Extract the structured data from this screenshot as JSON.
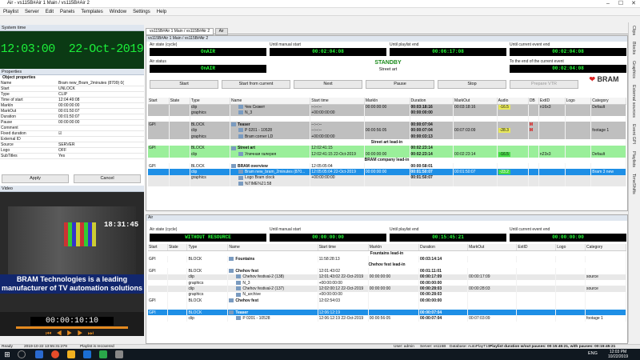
{
  "window": {
    "title": "Air - vs115B#Air 1 Main / vs115B#Air 2"
  },
  "menu": [
    "Playlist",
    "Server",
    "Edit",
    "Panels",
    "Templates",
    "Window",
    "Settings",
    "Help"
  ],
  "system_time": {
    "header": "System time",
    "time": "12:03:00",
    "date": "22-Oct-2019"
  },
  "properties": {
    "header": "Properties",
    "group": "Object properties",
    "rows": [
      [
        "Name",
        "Bram new_Bram_2minutes (8709) 0("
      ],
      [
        "Start",
        "UNLOCK"
      ],
      [
        "Type",
        "CLIP"
      ],
      [
        "Time of start",
        "12:04:49:08"
      ],
      [
        "MarkIn",
        "00:00:00:00"
      ],
      [
        "MarkOut",
        "00:01:50:07"
      ],
      [
        "Duration",
        "00:01:50:07"
      ],
      [
        "Pause",
        "00:00:00:00"
      ],
      [
        "Comment",
        ""
      ],
      [
        "Fixed duration",
        "☑"
      ],
      [
        "External ID",
        ""
      ],
      [
        "Source",
        "SERVER"
      ],
      [
        "Logo",
        "OFF"
      ],
      [
        "SubTitles",
        "Yes"
      ]
    ],
    "apply": "Apply",
    "cancel": "Cancel"
  },
  "video": {
    "header": "Video",
    "caption": "BRAM Technologies is a leading manufacturer of TV automation solutions",
    "clock": "18:31:45",
    "timecode": "00:00:10:10"
  },
  "tabs": [
    "vs115B#Air 1 Main / vs115B#Air 2",
    "Air"
  ],
  "air1": {
    "state_label": "Air state (cycle)",
    "state": "OnAIR",
    "manual_label": "Until manual start",
    "manual": "00:02:04:08",
    "pl_end_label": "Until playlist end",
    "pl_end": "00:06:17:08",
    "ev_end_label": "Until current event end",
    "ev_end": "00:02:04:08",
    "status_label": "Air status",
    "status": "OnAIR",
    "standby": "STANDBY",
    "street": "Street art",
    "next_label": "To the end of the current event",
    "next": "00:02:04:08",
    "buttons": [
      "Start",
      "Start from current",
      "Next",
      "Pause",
      "Stop",
      "Prepare VTR"
    ],
    "logo": "BRAM"
  },
  "grid_headers": [
    "Start",
    "State",
    "Type",
    "Name",
    "Start time",
    "MarkIn",
    "Duration",
    "MarkOut",
    "Audio",
    "DB",
    "ExtID",
    "Logo",
    "Category"
  ],
  "grid1": [
    {
      "c": "gr",
      "start": "",
      "type": "clip",
      "name": "Чек Сюжет",
      "st": "--:--:--",
      "mi": "00:00:00:00",
      "du": "00:03:18:16",
      "mo": "00:03:18:16",
      "au": "-16.5",
      "db": "",
      "ext": "n16x3",
      "cat": "Default"
    },
    {
      "c": "gr",
      "start": "",
      "type": "graphics",
      "name": "N_3",
      "st": "+00:00:00:00",
      "mi": "",
      "du": "00:00:00:00",
      "mo": "",
      "au": "",
      "db": "",
      "ext": "",
      "cat": ""
    },
    {
      "c": "wh",
      "start": "",
      "type": "",
      "name": "",
      "st": "",
      "mi": "",
      "du": "",
      "mo": "",
      "au": "",
      "db": "",
      "ext": "",
      "cat": ""
    },
    {
      "c": "gr",
      "start": "GPI",
      "type": "BLOCK",
      "name": "Teaser",
      "st": "--:--:--",
      "mi": "",
      "du": "00:00:07:04",
      "mo": "",
      "au": "",
      "db": "M",
      "ext": "",
      "cat": ""
    },
    {
      "c": "gr",
      "start": "",
      "type": "clip",
      "name": "P 0201 - 10528",
      "st": "--:--:--",
      "mi": "00:00:56:05",
      "du": "00:00:07:04",
      "mo": "00:07:03:09",
      "au": "-28.3",
      "db": "M",
      "ext": "",
      "cat": "footage 1"
    },
    {
      "c": "gr",
      "start": "",
      "type": "graphics",
      "name": "Bram corner LD",
      "st": "+00:00:00:00",
      "mi": "",
      "du": "00:00:03:13",
      "mo": "",
      "au": "",
      "db": "",
      "ext": "",
      "cat": ""
    },
    {
      "sec": "Street art lead-in"
    },
    {
      "c": "g",
      "start": "GPI",
      "type": "BLOCK",
      "name": "Street art",
      "st": "12:02:41:15",
      "mi": "",
      "du": "00:02:23:14",
      "mo": "",
      "au": "",
      "db": "",
      "ext": "",
      "cat": ""
    },
    {
      "c": "g",
      "start": "",
      "type": "clip",
      "name": "Уличная галерея",
      "st": "12:02:41:15  22-Oct-2019",
      "mi": "00:00:00:00",
      "du": "00:02:23:14",
      "mo": "00:02:23:14",
      "au": "-16.5",
      "db": "",
      "ext": "n23x3",
      "cat": "Default"
    },
    {
      "sec": "BRAM company lead-in"
    },
    {
      "c": "wh",
      "start": "GPI",
      "type": "BLOCK",
      "name": "BRAM overview",
      "st": "12:05:05:04",
      "mi": "",
      "du": "00:00:58:01",
      "mo": "",
      "au": "",
      "db": "",
      "ext": "",
      "cat": ""
    },
    {
      "c": "bl",
      "start": "",
      "type": "clip",
      "name": "Bram new_bram_2minutes (870...",
      "st": "12:05:05:04  22-Oct-2019",
      "mi": "00:00:00:00",
      "du": "00:01:50:07",
      "mo": "00:01:50:07",
      "au": "-23.2",
      "db": "",
      "ext": "",
      "cat": "Bram 3 new"
    },
    {
      "c": "ltg",
      "start": "",
      "type": "graphics",
      "name": "Logo Bram clock",
      "st": "+00:00:00:00",
      "mi": "",
      "du": "00:01:50:07",
      "mo": "",
      "au": "",
      "db": "",
      "ext": "",
      "cat": ""
    },
    {
      "c": "ltg",
      "start": "",
      "type": "",
      "name": "%TIME%21:58",
      "st": "",
      "mi": "",
      "du": "",
      "mo": "",
      "au": "",
      "db": "",
      "ext": "",
      "cat": ""
    }
  ],
  "air2": {
    "tab": "Air",
    "state": "WITHOUT RESOURCE",
    "manual": "00:00:00:00",
    "pl_end": "00:15:45:21",
    "ev_end": "00:00:00:00"
  },
  "grid2_headers": [
    "Start",
    "State",
    "Type",
    "Name",
    "Start time",
    "MarkIn",
    "Duration",
    "MarkOut",
    "ExtID",
    "Logo",
    "Category"
  ],
  "grid2": [
    {
      "sec": "Fountains lead-in"
    },
    {
      "c": "wh",
      "start": "GPI",
      "type": "BLOCK",
      "name": "Fountains",
      "st": "11:58:28:13",
      "mi": "",
      "du": "00:03:14:14",
      "mo": "",
      "cat": ""
    },
    {
      "sec": "Chehov fest lead-in"
    },
    {
      "c": "wh",
      "start": "GPI",
      "type": "BLOCK",
      "name": "Chehov fest",
      "st": "12:01:43:02",
      "mi": "",
      "du": "00:01:11:01",
      "mo": "",
      "cat": ""
    },
    {
      "c": "ltg",
      "start": "",
      "type": "clip",
      "name": "Chehov festival-2 (138)",
      "st": "12:01:43:02  22-Oct-2019",
      "mi": "00:00:00:00",
      "du": "00:00:17:09",
      "mo": "00:00:17:09",
      "cat": "source"
    },
    {
      "c": "wh",
      "start": "",
      "type": "graphics",
      "name": "N_3",
      "st": "+00:00:00:00",
      "mi": "",
      "du": "00:00:00:00",
      "mo": "",
      "cat": ""
    },
    {
      "c": "ltg",
      "start": "",
      "type": "clip",
      "name": "Chehov festival-2 (137)",
      "st": "12:02:00:12  22-Oct-2019",
      "mi": "00:00:00:00",
      "du": "00:00:28:03",
      "mo": "00:00:28:03",
      "cat": "source"
    },
    {
      "c": "wh",
      "start": "",
      "type": "graphics",
      "name": "N_archive",
      "st": "+00:00:00:00",
      "mi": "",
      "du": "00:00:28:03",
      "mo": "",
      "cat": ""
    },
    {
      "c": "wh",
      "start": "GPI",
      "type": "BLOCK",
      "name": "Chehov fest",
      "st": "12:02:54:03",
      "mi": "",
      "du": "00:00:00:00",
      "mo": "",
      "cat": ""
    },
    {
      "c": "wh",
      "start": "",
      "type": "",
      "name": "",
      "st": "",
      "mi": "",
      "du": "",
      "mo": "",
      "cat": ""
    },
    {
      "c": "bl",
      "start": "GPI",
      "type": "BLOCK",
      "name": "Teaser",
      "st": "12:06:12:19",
      "mi": "",
      "du": "00:00:07:04",
      "mo": "",
      "cat": ""
    },
    {
      "c": "wh",
      "start": "",
      "type": "clip",
      "name": "P 0201 - 10528",
      "st": "12:06:12:19  22-Oct-2019",
      "mi": "00:00:56:05",
      "du": "00:00:07:04",
      "mo": "00:07:03:09",
      "cat": "footage 1"
    }
  ],
  "vtabs": [
    "Clips",
    "Blocks",
    "Graphics",
    "External sources",
    "Event GPI",
    "Playlists",
    "TimeShifts"
  ],
  "status": {
    "ready": "Ready",
    "datetime": "2019-10-22 13:55:31:279",
    "recv": "Playlist is recovered",
    "user": "User: admin",
    "server": "Server: vs115B",
    "db": "Database: AutoPlayT10",
    "duration": "Playlist duration w/out pauses: 00:15:45:21, with pauses: 00:15:45:21"
  },
  "tray": {
    "lang": "ENG",
    "time": "12:03 PM",
    "date": "10/22/2019"
  }
}
